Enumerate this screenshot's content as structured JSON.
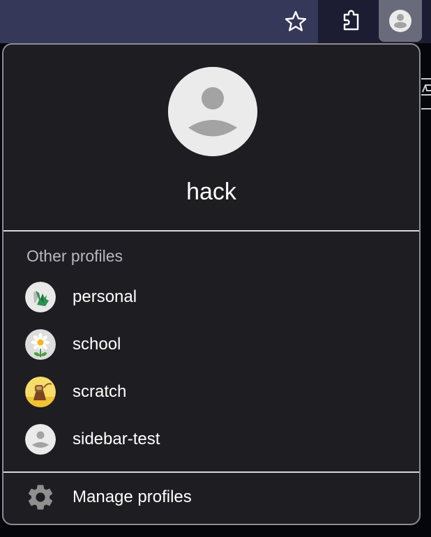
{
  "toolbar": {
    "buttons": [
      {
        "name": "bookmark-star",
        "icon": "star-icon"
      },
      {
        "name": "extensions",
        "icon": "puzzle-icon"
      },
      {
        "name": "profile",
        "icon": "avatar-icon"
      }
    ]
  },
  "profile_menu": {
    "current_profile": {
      "name": "hack",
      "avatar": "default-avatar-icon"
    },
    "other_profiles_title": "Other profiles",
    "other_profiles": [
      {
        "name": "personal",
        "avatar": "origami-dragon-avatar",
        "avatar_bg": "#e9e9e9"
      },
      {
        "name": "school",
        "avatar": "daisy-flower-avatar",
        "avatar_bg": "#dedede"
      },
      {
        "name": "scratch",
        "avatar": "monkey-avatar",
        "avatar_bg": "#f4d75a"
      },
      {
        "name": "sidebar-test",
        "avatar": "default-avatar-icon",
        "avatar_bg": "#ebebeb"
      }
    ],
    "manage_profiles_label": "Manage profiles",
    "manage_profiles_icon": "gear-icon"
  },
  "colors": {
    "toolbar_bg": "#363859",
    "panel_bg": "#1e1d22",
    "panel_border": "#8c8c93",
    "text_primary": "#ffffff",
    "text_secondary": "#b9b8c0",
    "avatar_bg": "#ebebeb",
    "avatar_fg": "#a3a3a3"
  }
}
